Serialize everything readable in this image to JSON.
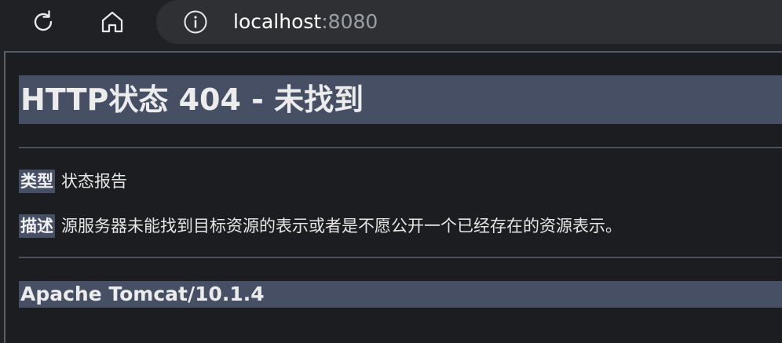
{
  "toolbar": {
    "reload_icon": "reload-icon",
    "home_icon": "home-icon",
    "info_icon": "info-icon",
    "url_host": "localhost",
    "url_port": ":8080"
  },
  "page": {
    "title": "HTTP状态 404 - 未找到",
    "type_label": "类型",
    "type_value": "状态报告",
    "desc_label": "描述",
    "desc_value": "源服务器未能找到目标资源的表示或者是不愿公开一个已经存在的资源表示。",
    "server_footer": "Apache Tomcat/10.1.4"
  },
  "colors": {
    "toolbar_bg": "#202124",
    "addressbar_bg": "#2f3033",
    "page_bg": "#1c1d20",
    "heading_bg": "#464f63",
    "text": "#e6e6e6",
    "port_text": "#9aa0a6"
  }
}
